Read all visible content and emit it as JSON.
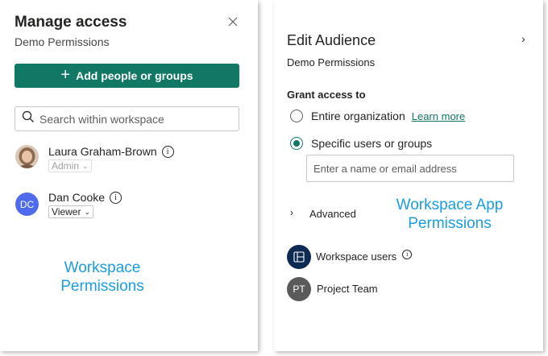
{
  "left": {
    "title": "Manage access",
    "subtitle": "Demo Permissions",
    "add_button": "Add people or groups",
    "search_placeholder": "Search within workspace",
    "people": [
      {
        "name": "Laura Graham-Brown",
        "role": "Admin",
        "role_disabled": true,
        "avatar": "photo"
      },
      {
        "name": "Dan Cooke",
        "role": "Viewer",
        "role_disabled": false,
        "initials": "DC"
      }
    ],
    "annotation": [
      "Workspace",
      "Permissions"
    ]
  },
  "right": {
    "title": "Edit Audience",
    "subtitle": "Demo Permissions",
    "grant_heading": "Grant access to",
    "option_entire": "Entire organization",
    "learn_more": "Learn more",
    "option_specific": "Specific users or groups",
    "selected_option": "Specific users or groups",
    "name_placeholder": "Enter a name or email address",
    "advanced": "Advanced",
    "annotation": [
      "Workspace App",
      "Permissions"
    ],
    "audience": [
      {
        "label": "Workspace users",
        "icon": "workspace-icon"
      },
      {
        "label": "Project Team",
        "initials": "PT"
      }
    ]
  },
  "colors": {
    "accent": "#117865",
    "annotation": "#1b9de2",
    "dc_avatar": "#4f6bed",
    "workspace_avatar": "#0d2a52",
    "pt_avatar": "#5a5a5a"
  }
}
